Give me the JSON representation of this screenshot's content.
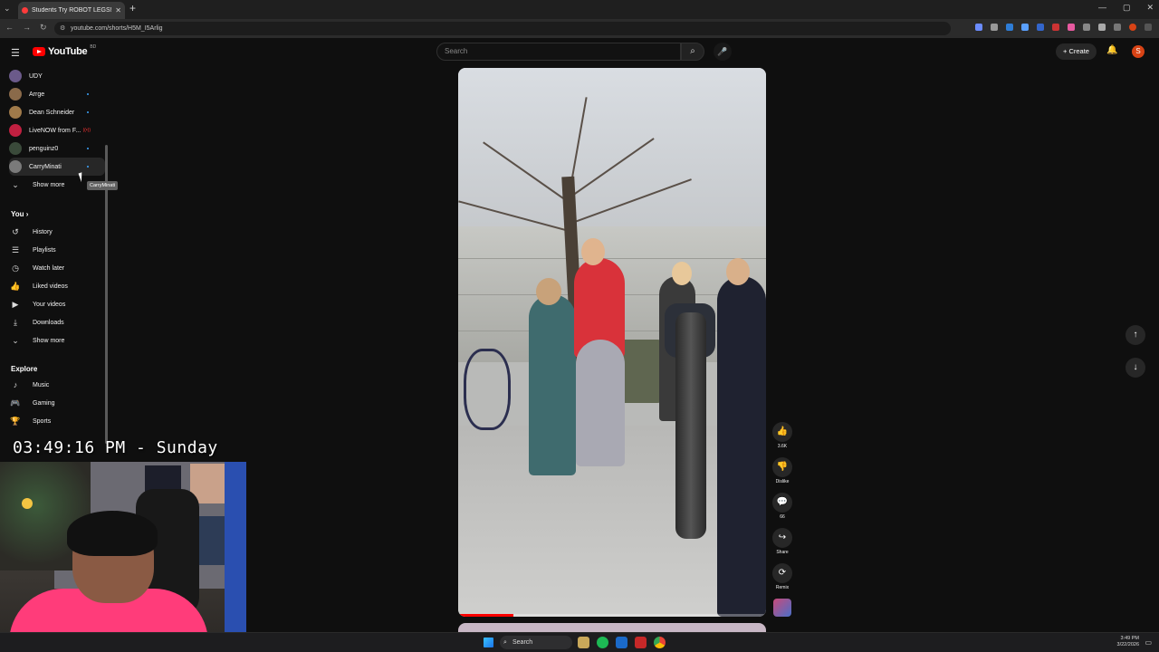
{
  "browser": {
    "tab_title": "Students Try ROBOT LEGS!!",
    "url": "youtube.com/shorts/H5M_I5Arlig",
    "new_tab_glyph": "+",
    "window_controls": [
      "—",
      "▢",
      "✕"
    ]
  },
  "masthead": {
    "logo_text": "YouTube",
    "country_code": "BD",
    "search_placeholder": "Search",
    "create_label": "Create",
    "avatar_letter": "S",
    "accent": "#ff0000"
  },
  "sidebar": {
    "subscriptions": [
      {
        "label": "UDY",
        "color": "#6b5a8a",
        "indicator": ""
      },
      {
        "label": "Arrge",
        "color": "#8a6a4a",
        "indicator": "dot"
      },
      {
        "label": "Dean Schneider",
        "color": "#a07a4a",
        "indicator": "dot"
      },
      {
        "label": "LiveNOW from F...",
        "color": "#c02040",
        "indicator": "live"
      },
      {
        "label": "penguinz0",
        "color": "#3a4a3a",
        "indicator": "dot"
      },
      {
        "label": "CarryMinati",
        "color": "#7a7a7a",
        "indicator": "dot"
      }
    ],
    "show_more_label": "Show more",
    "tooltip": "CarryMinati",
    "you_label": "You",
    "you_items": [
      {
        "label": "History",
        "icon": "history-icon",
        "glyph": "↺"
      },
      {
        "label": "Playlists",
        "icon": "playlists-icon",
        "glyph": "☰"
      },
      {
        "label": "Watch later",
        "icon": "clock-icon",
        "glyph": "◷"
      },
      {
        "label": "Liked videos",
        "icon": "thumb-up-icon",
        "glyph": "👍"
      },
      {
        "label": "Your videos",
        "icon": "video-icon",
        "glyph": "▶"
      },
      {
        "label": "Downloads",
        "icon": "download-icon",
        "glyph": "⤓"
      }
    ],
    "show_more_label_2": "Show more",
    "explore_label": "Explore",
    "explore_items": [
      {
        "label": "Music",
        "icon": "music-icon",
        "glyph": "♪"
      },
      {
        "label": "Gaming",
        "icon": "gaming-icon",
        "glyph": "🎮"
      },
      {
        "label": "Sports",
        "icon": "trophy-icon",
        "glyph": "🏆"
      }
    ]
  },
  "overlay_clock": "03:49:16 PM - Sunday",
  "player": {
    "progress_fraction": 0.18
  },
  "actions": [
    {
      "name": "like",
      "icon": "thumb-up-icon",
      "glyph": "👍",
      "label": "3.6K"
    },
    {
      "name": "dislike",
      "icon": "thumb-down-icon",
      "glyph": "👎",
      "label": "Dislike"
    },
    {
      "name": "comments",
      "icon": "comment-icon",
      "glyph": "💬",
      "label": "66"
    },
    {
      "name": "share",
      "icon": "share-icon",
      "glyph": "↪",
      "label": "Share"
    },
    {
      "name": "remix",
      "icon": "remix-icon",
      "glyph": "⟳",
      "label": "Remix"
    }
  ],
  "nav": {
    "up_glyph": "↑",
    "down_glyph": "↓"
  },
  "taskbar": {
    "search_label": "Search",
    "time": "3:49 PM",
    "date": "3/22/2026"
  }
}
